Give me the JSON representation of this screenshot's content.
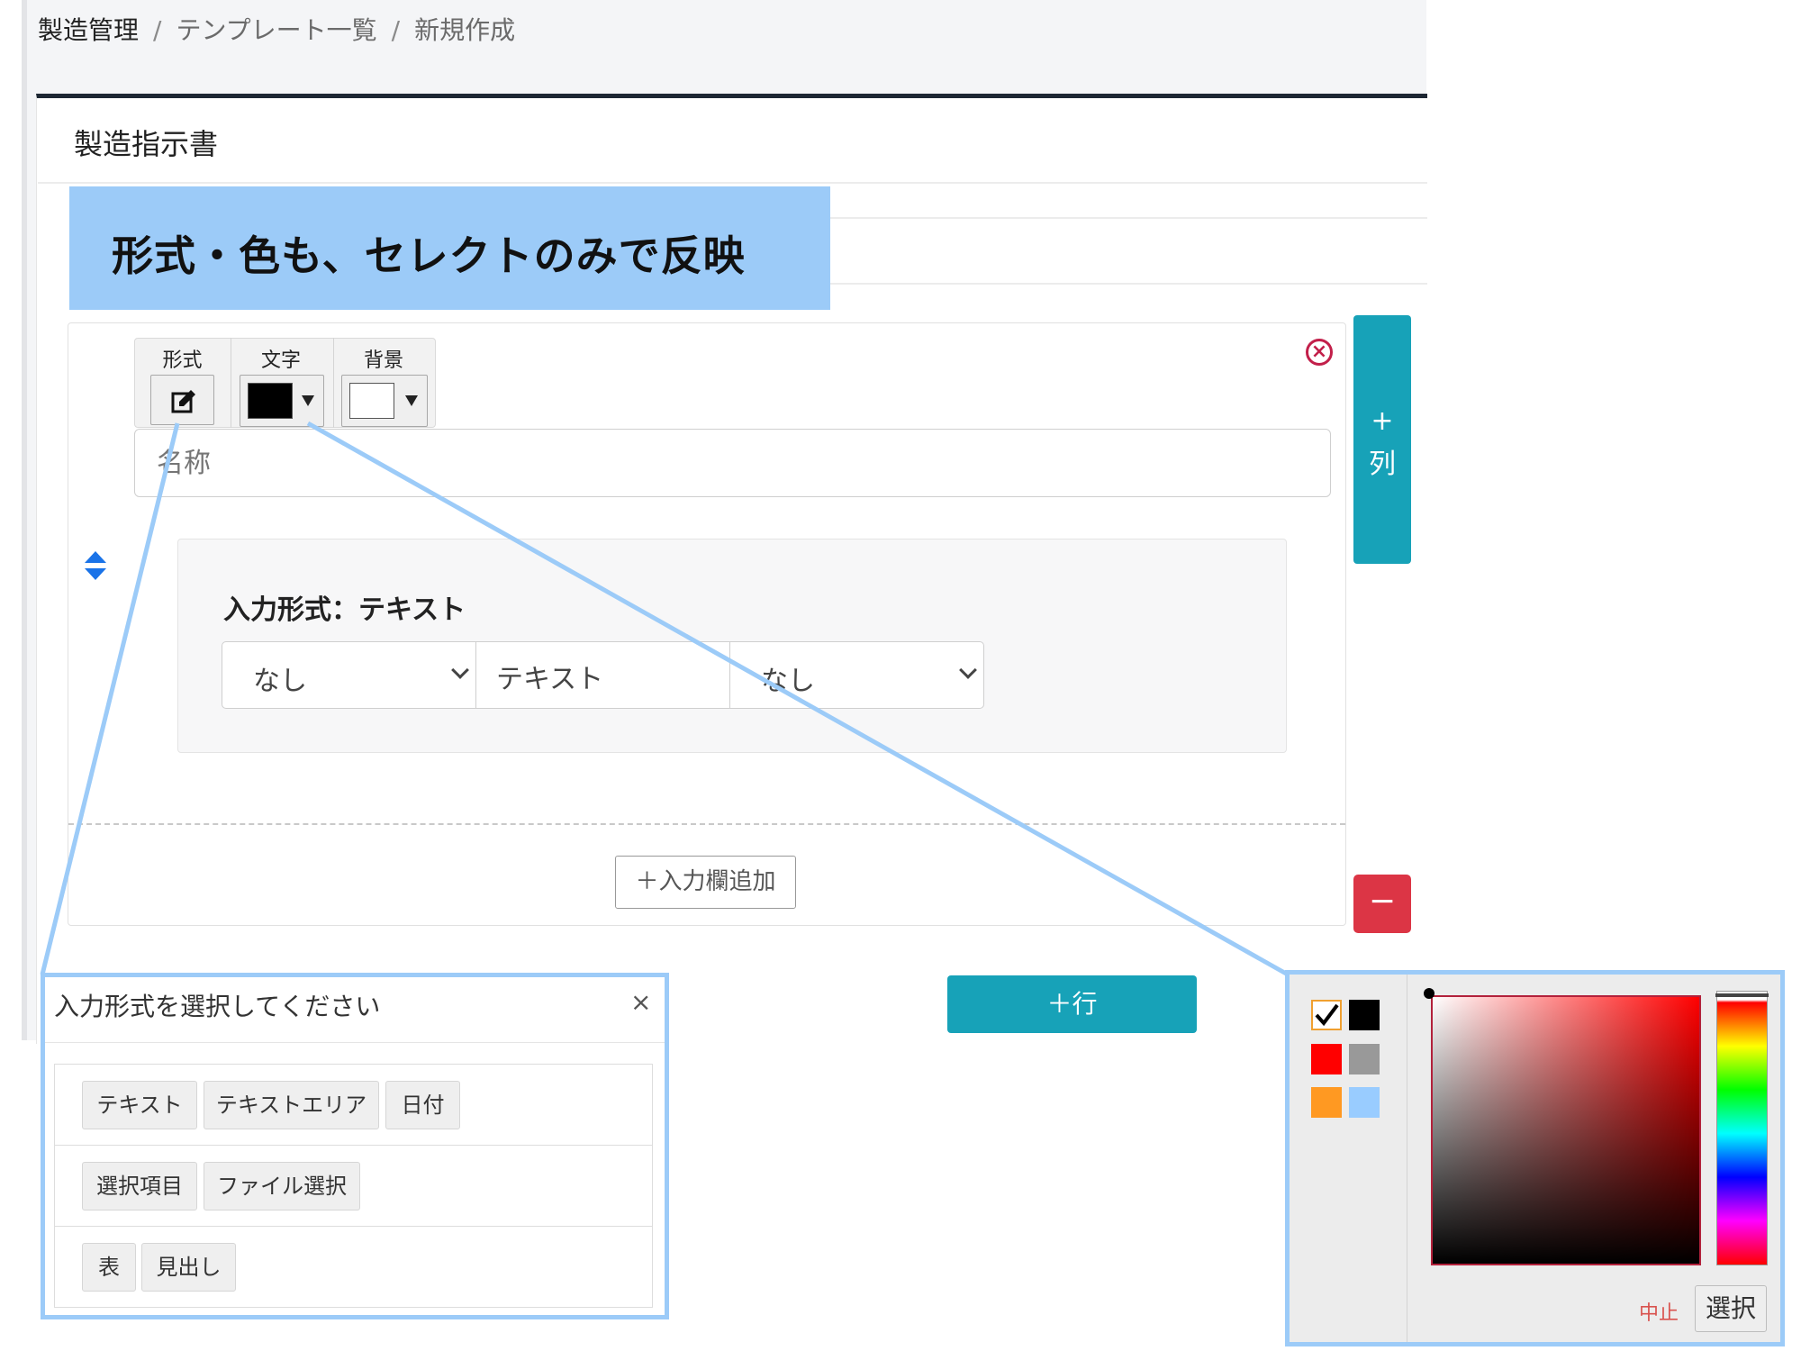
{
  "breadcrumb": {
    "items": [
      "製造管理",
      "テンプレート一覧",
      "新規作成"
    ],
    "separator": "/"
  },
  "card": {
    "title": "製造指示書"
  },
  "callout": {
    "text": "形式・色も、セレクトのみで反映",
    "color": "#9ccbf8"
  },
  "toolbar": {
    "format_label": "形式",
    "text_label": "文字",
    "bg_label": "背景",
    "format_icon": "edit-icon",
    "text_color": "#000000",
    "bg_color": "#ffffff"
  },
  "name_input": {
    "placeholder": "名称"
  },
  "field": {
    "type_label": "入力形式：テキスト",
    "left_select": "なし",
    "text_value": "テキスト",
    "right_select": "なし"
  },
  "buttons": {
    "add_input": "＋入力欄追加",
    "add_column_plus": "+",
    "add_column_label": "列",
    "remove": "−",
    "add_row": "＋行",
    "close_icon": "circle-x-icon"
  },
  "dialog": {
    "title": "入力形式を選択してください",
    "close": "×",
    "groups": [
      [
        "テキスト",
        "テキストエリア",
        "日付"
      ],
      [
        "選択項目",
        "ファイル選択"
      ],
      [
        "表",
        "見出し"
      ]
    ]
  },
  "color_picker": {
    "swatches": [
      "#ffffff",
      "#000000",
      "#ff0000",
      "#999999",
      "#ff9922",
      "#99ccff"
    ],
    "selected_swatch": "#ffffff",
    "cancel": "中止",
    "select": "選択"
  },
  "colors": {
    "teal": "#17a2b8",
    "danger": "#dc3545",
    "callout_border": "#9ccbf8"
  }
}
